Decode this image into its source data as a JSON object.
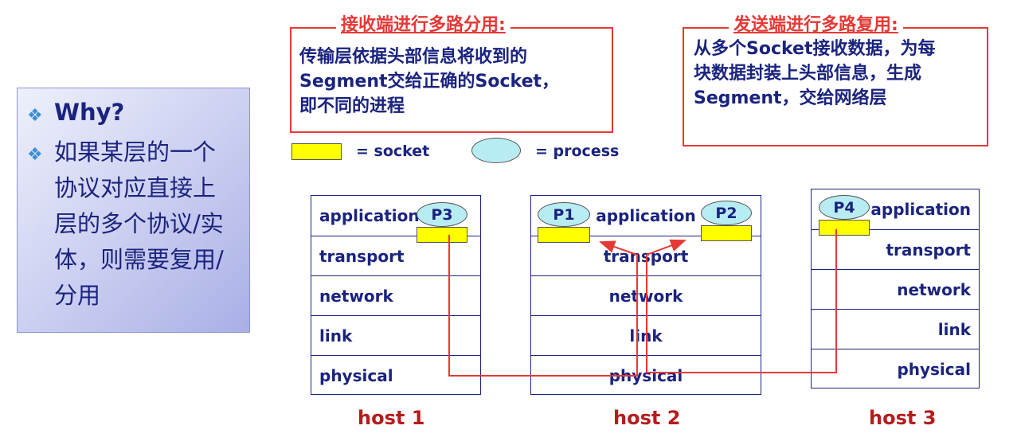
{
  "why_panel": {
    "bullet_icon": "diamond-bullet-icon",
    "title": "Why?",
    "lines": [
      "如果某层的一个",
      "协议对应直接上",
      "层的多个协议/实",
      "体，则需要复用/",
      "分用"
    ]
  },
  "demux_callout": {
    "title": "接收端进行多路分用:",
    "body": "传输层依据头部信息将收到的\nSegment交给正确的Socket，\n即不同的进程"
  },
  "mux_callout": {
    "title": "发送端进行多路复用:",
    "body": "从多个Socket接收数据，为每\n块数据封装上头部信息，生成\nSegment，交给网络层"
  },
  "legend": {
    "socket_label": "= socket",
    "process_label": "= process"
  },
  "hosts": [
    {
      "label": "host 1",
      "layers": [
        "application",
        "transport",
        "network",
        "link",
        "physical"
      ],
      "processes": [
        "P3"
      ]
    },
    {
      "label": "host 2",
      "layers": [
        "application",
        "transport",
        "network",
        "link",
        "physical"
      ],
      "processes": [
        "P1",
        "P2"
      ]
    },
    {
      "label": "host 3",
      "layers": [
        "application",
        "transport",
        "network",
        "link",
        "physical"
      ],
      "processes": [
        "P4"
      ]
    }
  ],
  "colors": {
    "accent_red": "#e53935",
    "text_navy": "#1a237e",
    "socket_yellow": "#ffff00",
    "process_cyan": "#b8ecf3",
    "host_label_red": "#b71c1c"
  }
}
